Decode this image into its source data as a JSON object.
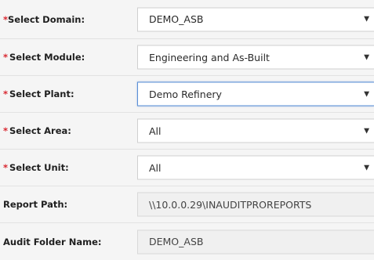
{
  "form": {
    "required_mark": "*",
    "dropdown_icon": "▼",
    "domain": {
      "label": "Select Domain:",
      "value": "DEMO_ASB"
    },
    "module": {
      "label": "Select Module:",
      "value": "Engineering and As-Built"
    },
    "plant": {
      "label": "Select Plant:",
      "value": "Demo Refinery"
    },
    "area": {
      "label": "Select Area:",
      "value": "All"
    },
    "unit": {
      "label": "Select Unit:",
      "value": "All"
    },
    "report_path": {
      "label": "Report Path:",
      "value": "\\\\10.0.0.29\\INAUDITPROREPORTS"
    },
    "audit_folder": {
      "label": "Audit Folder Name:",
      "value": "DEMO_ASB"
    }
  },
  "colors": {
    "required": "#d8262f",
    "row_background": "#f5f5f5",
    "focus_border": "#5a8fd6"
  }
}
